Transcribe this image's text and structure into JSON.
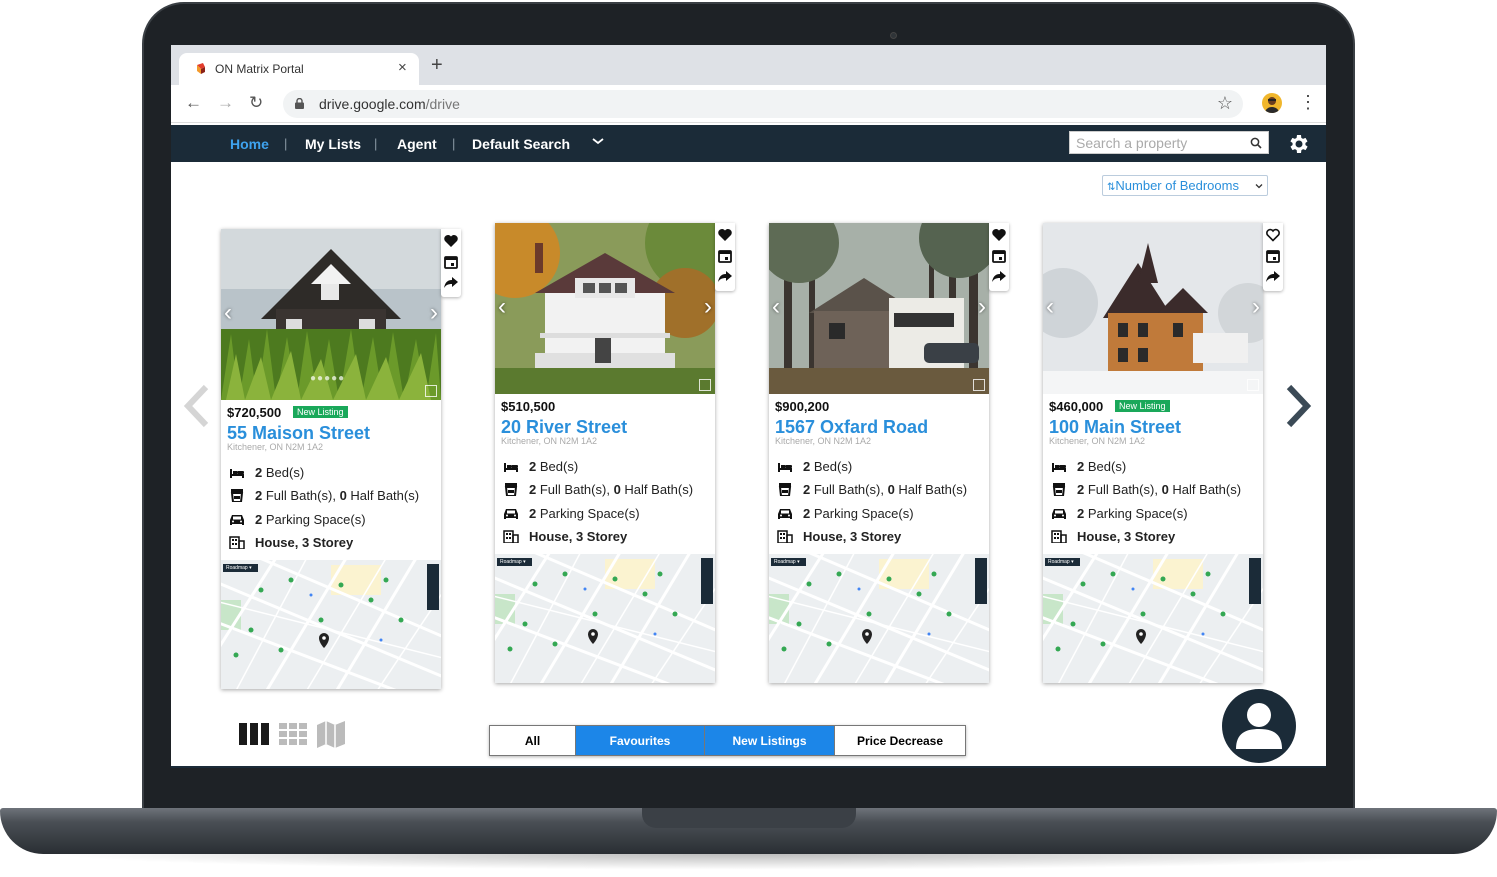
{
  "browser": {
    "tab_title": "ON Matrix Portal",
    "close_glyph": "×",
    "new_tab_glyph": "+",
    "url_domain": "drive.google.com",
    "url_path": "/drive",
    "back_glyph": "←",
    "forward_glyph": "→",
    "reload_glyph": "↻",
    "star_glyph": "☆",
    "menu_glyph": "⋮"
  },
  "nav": {
    "items": [
      {
        "label": "Home",
        "active": true
      },
      {
        "label": "My Lists"
      },
      {
        "label": "Agent"
      },
      {
        "label": "Default Search"
      }
    ],
    "separator": "|",
    "search_placeholder": "Search a property"
  },
  "sort": {
    "label": "Number of Bedrooms",
    "glyph": "⇅"
  },
  "listings": [
    {
      "price": "$720,500",
      "badge": "New Listing",
      "street": "55 Maison Street",
      "city": "Kitchener, ON N2M 1A2",
      "beds": "2",
      "beds_label": "Bed(s)",
      "full_baths": "2",
      "full_label": "Full Bath(s),",
      "half_baths": "0",
      "half_label": "Half Bath(s)",
      "parking": "2",
      "parking_label": "Parking Space(s)",
      "type": "House, 3 Storey",
      "favourited": true
    },
    {
      "price": "$510,500",
      "badge": "",
      "street": "20 River Street",
      "city": "Kitchener, ON N2M 1A2",
      "beds": "2",
      "beds_label": "Bed(s)",
      "full_baths": "2",
      "full_label": "Full Bath(s),",
      "half_baths": "0",
      "half_label": "Half Bath(s)",
      "parking": "2",
      "parking_label": "Parking Space(s)",
      "type": "House, 3 Storey",
      "favourited": true
    },
    {
      "price": "$900,200",
      "badge": "",
      "street": "1567 Oxfard Road",
      "city": "Kitchener, ON N2M 1A2",
      "beds": "2",
      "beds_label": "Bed(s)",
      "full_baths": "2",
      "full_label": "Full Bath(s),",
      "half_baths": "0",
      "half_label": "Half Bath(s)",
      "parking": "2",
      "parking_label": "Parking Space(s)",
      "type": "House, 3 Storey",
      "favourited": true
    },
    {
      "price": "$460,000",
      "badge": "New Listing",
      "street": "100 Main Street",
      "city": "Kitchener, ON N2M 1A2",
      "beds": "2",
      "beds_label": "Bed(s)",
      "full_baths": "2",
      "full_label": "Full Bath(s),",
      "half_baths": "0",
      "half_label": "Half Bath(s)",
      "parking": "2",
      "parking_label": "Parking Space(s)",
      "type": "House, 3 Storey",
      "favourited": false
    }
  ],
  "map": {
    "roadmap_label": "Roadmap"
  },
  "filters": [
    {
      "label": "All",
      "active": false
    },
    {
      "label": "Favourites",
      "active": true
    },
    {
      "label": "New Listings",
      "active": true
    },
    {
      "label": "Price Decrease",
      "active": false
    }
  ],
  "colors": {
    "nav_bg": "#1b2b38",
    "accent_blue": "#2a8fdb",
    "filter_active": "#1c86e8",
    "badge_green": "#1aa85a"
  }
}
